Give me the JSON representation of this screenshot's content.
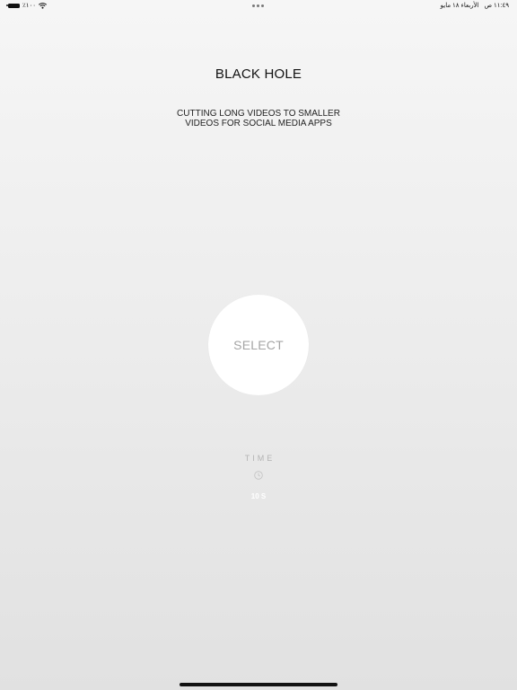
{
  "status_bar": {
    "battery_percent": "٪١٠٠",
    "battery_level": 1.0,
    "time": "١١:٤٩ ص",
    "date": "الأربعاء ١٨ مايو",
    "icons": [
      "battery-icon",
      "wifi-icon",
      "more-dots-icon"
    ]
  },
  "header": {
    "title": "BLACK HOLE",
    "subtitle_line1": "CUTTING LONG VIDEOS TO SMALLER",
    "subtitle_line2": "VIDEOS FOR SOCIAL MEDIA APPS"
  },
  "main": {
    "select_label": "SELECT",
    "time_label": "TIME",
    "time_value": "10 S",
    "time_icon": "clock-icon"
  },
  "colors": {
    "background_top": "#f6f6f6",
    "background_bottom": "#e1e1e1",
    "select_button_bg": "#ffffff",
    "select_label": "#a5a5a5",
    "time_label": "#b3b3b3",
    "time_value": "#ffffff"
  }
}
